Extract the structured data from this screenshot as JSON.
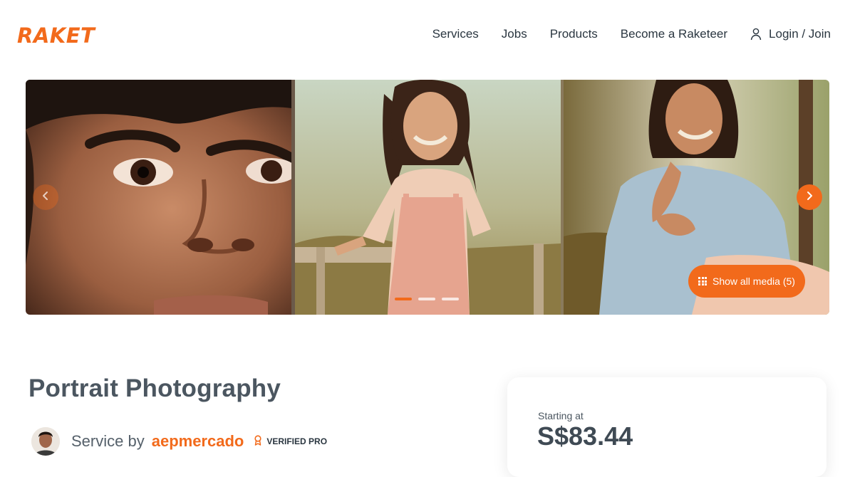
{
  "brand": {
    "logo_text": "RAKET",
    "accent": "#f26a1b"
  },
  "nav": {
    "items": [
      "Services",
      "Jobs",
      "Products",
      "Become a Raketeer"
    ],
    "login_label": "Login / Join",
    "login_icon": "user-icon"
  },
  "gallery": {
    "show_media_label": "Show all media (5)",
    "dots_count": 3,
    "active_dot": 0,
    "prev_icon": "chevron-left-icon",
    "next_icon": "chevron-right-icon"
  },
  "listing": {
    "title": "Portrait Photography",
    "service_by": "Service by",
    "username": "aepmercado",
    "badge": "VERIFIED PRO"
  },
  "pricing": {
    "starting_label": "Starting at",
    "price": "S$83.44"
  }
}
